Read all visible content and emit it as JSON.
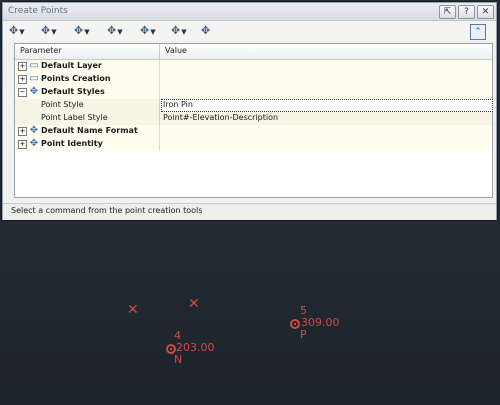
{
  "dialog": {
    "title": "Create Points",
    "titlebar_buttons": [
      {
        "name": "autohide",
        "glyph": "⇱"
      },
      {
        "name": "help",
        "glyph": "?"
      },
      {
        "name": "close",
        "glyph": "✕"
      }
    ],
    "toolbar_tools": [
      {
        "name": "miscellaneous-point-tool",
        "glyph": "✥"
      },
      {
        "name": "intersection-point-tool",
        "glyph": "✥"
      },
      {
        "name": "alignment-point-tool",
        "glyph": "✥"
      },
      {
        "name": "surface-point-tool",
        "glyph": "✥"
      },
      {
        "name": "interpolate-point-tool",
        "glyph": "✥"
      },
      {
        "name": "slope-point-tool",
        "glyph": "✥"
      },
      {
        "name": "convert-point-tool",
        "glyph": "✥"
      }
    ],
    "collapse_glyph": "⌃"
  },
  "grid": {
    "col_parameter": "Parameter",
    "col_value": "Value",
    "rows": [
      {
        "type": "group",
        "label": "Default Layer",
        "expanded": false,
        "icon": "layer-icon",
        "value": ""
      },
      {
        "type": "group",
        "label": "Points Creation",
        "expanded": false,
        "icon": "points-creation-icon",
        "value": ""
      },
      {
        "type": "group",
        "label": "Default Styles",
        "expanded": true,
        "icon": "styles-icon",
        "value": ""
      },
      {
        "type": "child",
        "label": "Point Style",
        "value": "Iron Pin",
        "selected": true
      },
      {
        "type": "child",
        "label": "Point Label Style",
        "value": "Point#-Elevation-Description",
        "selected": false
      },
      {
        "type": "group",
        "label": "Default Name Format",
        "expanded": false,
        "icon": "name-format-icon",
        "value": ""
      },
      {
        "type": "group",
        "label": "Point Identity",
        "expanded": false,
        "icon": "identity-icon",
        "value": ""
      }
    ]
  },
  "status_text": "Select a command from the point creation tools",
  "drawing": {
    "color": "#d24a3f",
    "points": [
      {
        "number": "4",
        "elevation": "203.00",
        "description": "N"
      },
      {
        "number": "5",
        "elevation": "309.00",
        "description": "P"
      }
    ],
    "markers": [
      "x-marker",
      "x-marker"
    ]
  }
}
